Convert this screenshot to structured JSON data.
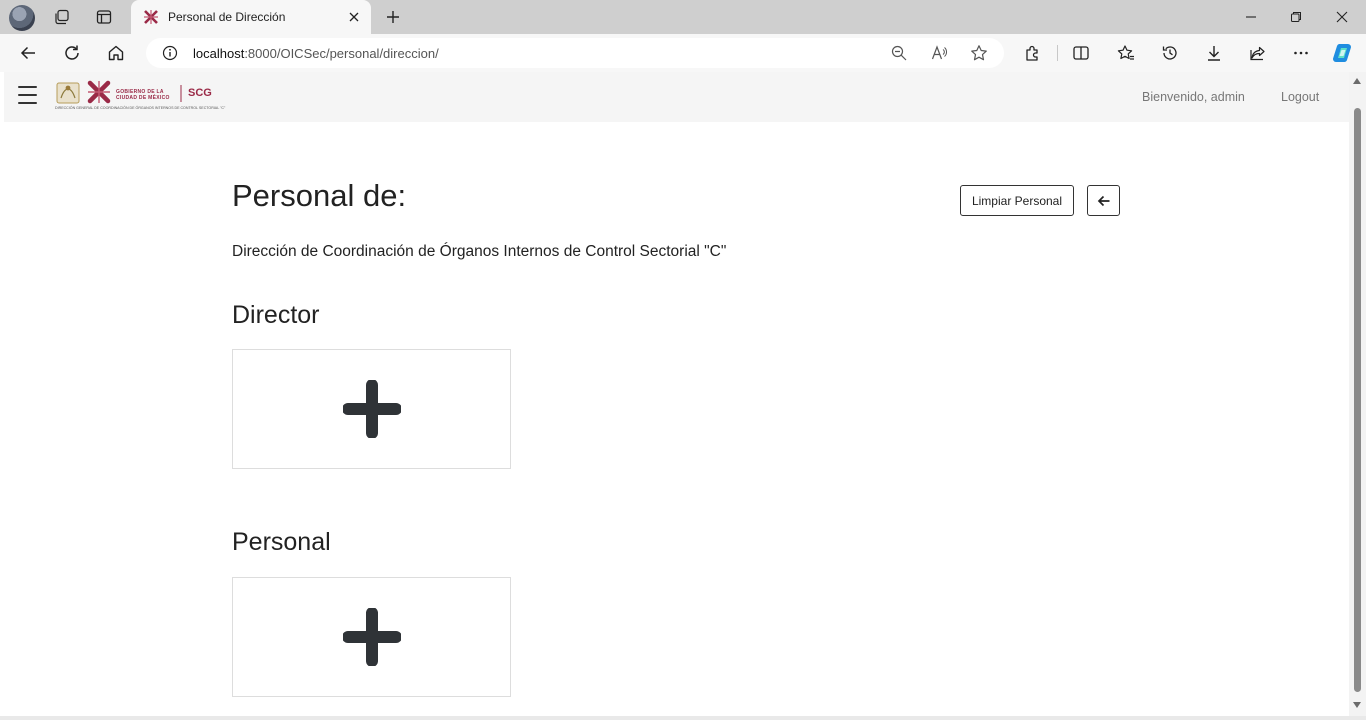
{
  "browser": {
    "tab_title": "Personal de Dirección",
    "url_host": "localhost",
    "url_path": ":8000/OICSec/personal/direccion/",
    "icons": [
      "profile-avatar",
      "workspaces-icon",
      "tab-actions-icon",
      "new-tab-icon",
      "minimize-icon",
      "restore-icon",
      "close-icon",
      "back-icon",
      "refresh-icon",
      "home-icon",
      "info-icon",
      "zoom-out-icon",
      "read-aloud-icon",
      "favorite-star-icon",
      "extensions-icon",
      "split-screen-icon",
      "favorites-icon",
      "history-icon",
      "downloads-icon",
      "share-icon",
      "more-icon",
      "copilot-icon"
    ]
  },
  "navbar": {
    "logo_gov_line1": "GOBIERNO DE LA",
    "logo_gov_line2": "CIUDAD DE MÉXICO",
    "logo_scg": "SCG",
    "logo_sub": "DIRECCIÓN GENERAL DE COORDINACIÓN DE ÓRGANOS INTERNOS DE CONTROL SECTORIAL \"C\"",
    "welcome": "Bienvenido,  admin",
    "logout": "Logout"
  },
  "page": {
    "title": "Personal de:",
    "limpiar_label": "Limpiar Personal",
    "subtitle": "Dirección de Coordinación de Órganos Internos de Control Sectorial \"C\"",
    "sections": [
      {
        "heading": "Director"
      },
      {
        "heading": "Personal"
      }
    ]
  },
  "colors": {
    "brand": "#9a2a47",
    "text": "#222222",
    "navbar_bg": "#f5f5f5",
    "plus_icon": "#2f3337"
  }
}
